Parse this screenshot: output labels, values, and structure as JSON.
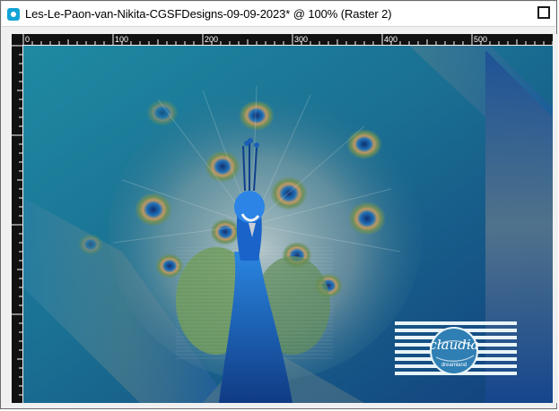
{
  "window": {
    "title": "Les-Le-Paon-van-Nikita-CGSFDesigns-09-09-2023* @ 100% (Raster 2)"
  },
  "ruler": {
    "labels": [
      "0",
      "100",
      "200",
      "300",
      "400",
      "500"
    ]
  },
  "watermark": {
    "text": "claudia",
    "subtext": "dreamland"
  },
  "colors": {
    "teal": "#1c8aa0",
    "blue": "#1650a0",
    "peacock_body": "#1a63c9",
    "feather_green": "#6f9a5c"
  }
}
